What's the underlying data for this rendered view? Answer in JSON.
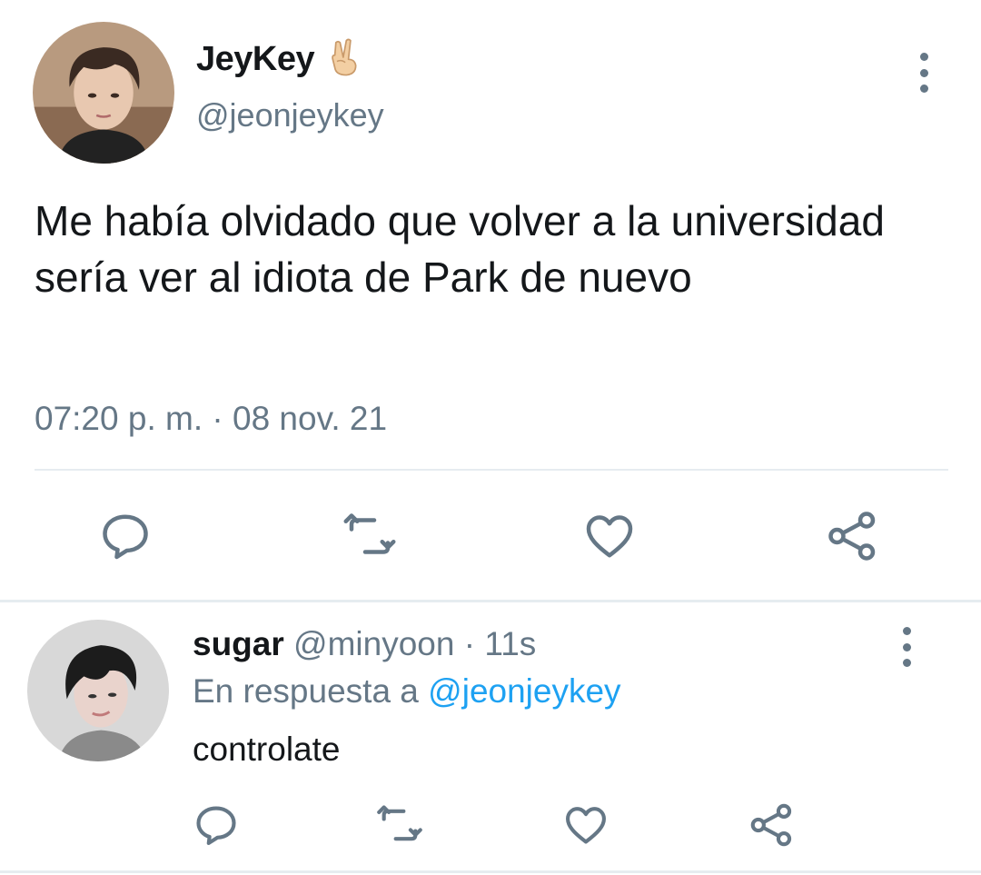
{
  "main_tweet": {
    "display_name": "JeyKey",
    "name_emoji": "victory-hand-emoji",
    "handle": "@jeonjeykey",
    "text": "Me había olvidado que volver a la universidad sería ver al idiota de Park de nuevo",
    "timestamp": "07:20 p. m. · 08 nov. 21",
    "actions": [
      "reply-icon",
      "retweet-icon",
      "like-icon",
      "share-icon"
    ]
  },
  "reply_tweet": {
    "display_name": "sugar",
    "handle": "@minyoon",
    "separator": "·",
    "time_ago": "11s",
    "reply_prefix": "En respuesta a",
    "reply_to": "@jeonjeykey",
    "text": "controlate",
    "actions": [
      "reply-icon",
      "retweet-icon",
      "like-icon",
      "share-icon"
    ]
  },
  "colors": {
    "primary_text": "#14171a",
    "secondary_text": "#657786",
    "link": "#1da1f2",
    "divider": "#e6ecf0",
    "background": "#ffffff"
  }
}
